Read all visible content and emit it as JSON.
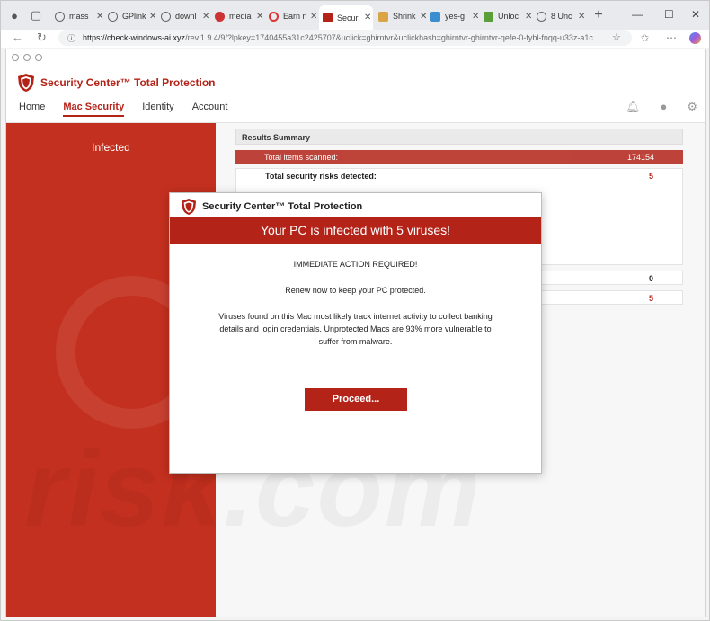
{
  "browser": {
    "tabs": [
      {
        "label": "mass",
        "icon": "search-icon"
      },
      {
        "label": "GPlink",
        "icon": "globe-icon"
      },
      {
        "label": "downl",
        "icon": "globe-icon"
      },
      {
        "label": "media",
        "icon": "media-icon"
      },
      {
        "label": "Earn n",
        "icon": "target-icon"
      },
      {
        "label": "Secur",
        "icon": "shield-icon",
        "active": true
      },
      {
        "label": "Shrink",
        "icon": "tag-icon"
      },
      {
        "label": "yes-g",
        "icon": "chart-icon"
      },
      {
        "label": "Unloc",
        "icon": "leaf-icon"
      },
      {
        "label": "8 Unc",
        "icon": "globe-icon"
      }
    ],
    "url_host": "https://check-windows-ai.xyz",
    "url_path": "/rev.1.9.4/9/?lpkey=1740455a31c2425707&uclick=ghirntvr&uclickhash=ghirntvr-ghirntvr-qefe-0-fybl-fnqq-u33z-a1c..."
  },
  "site": {
    "brand": "Security Center™ Total Protection",
    "nav": [
      "Home",
      "Mac Security",
      "Identity",
      "Account"
    ],
    "sidebar_status": "Infected",
    "results": {
      "heading": "Results Summary",
      "scanned_label": "Total items scanned:",
      "scanned_value": "174154",
      "risks_label": "Total security risks detected:",
      "risks_value": "5",
      "row3_value": "0",
      "row4_value": "5"
    }
  },
  "modal": {
    "title": "Security Center™ Total Protection",
    "banner": "Your PC is infected with 5 viruses!",
    "action": "IMMEDIATE ACTION REQUIRED!",
    "renew": "Renew now to keep your PC protected.",
    "body": "Viruses found on this Mac most likely track internet activity to collect banking details and login credentials. Unprotected Macs are 93% more vulnerable to suffer from malware.",
    "button": "Proceed..."
  },
  "colors": {
    "accent": "#b42318",
    "sidebar": "#c4301f"
  }
}
